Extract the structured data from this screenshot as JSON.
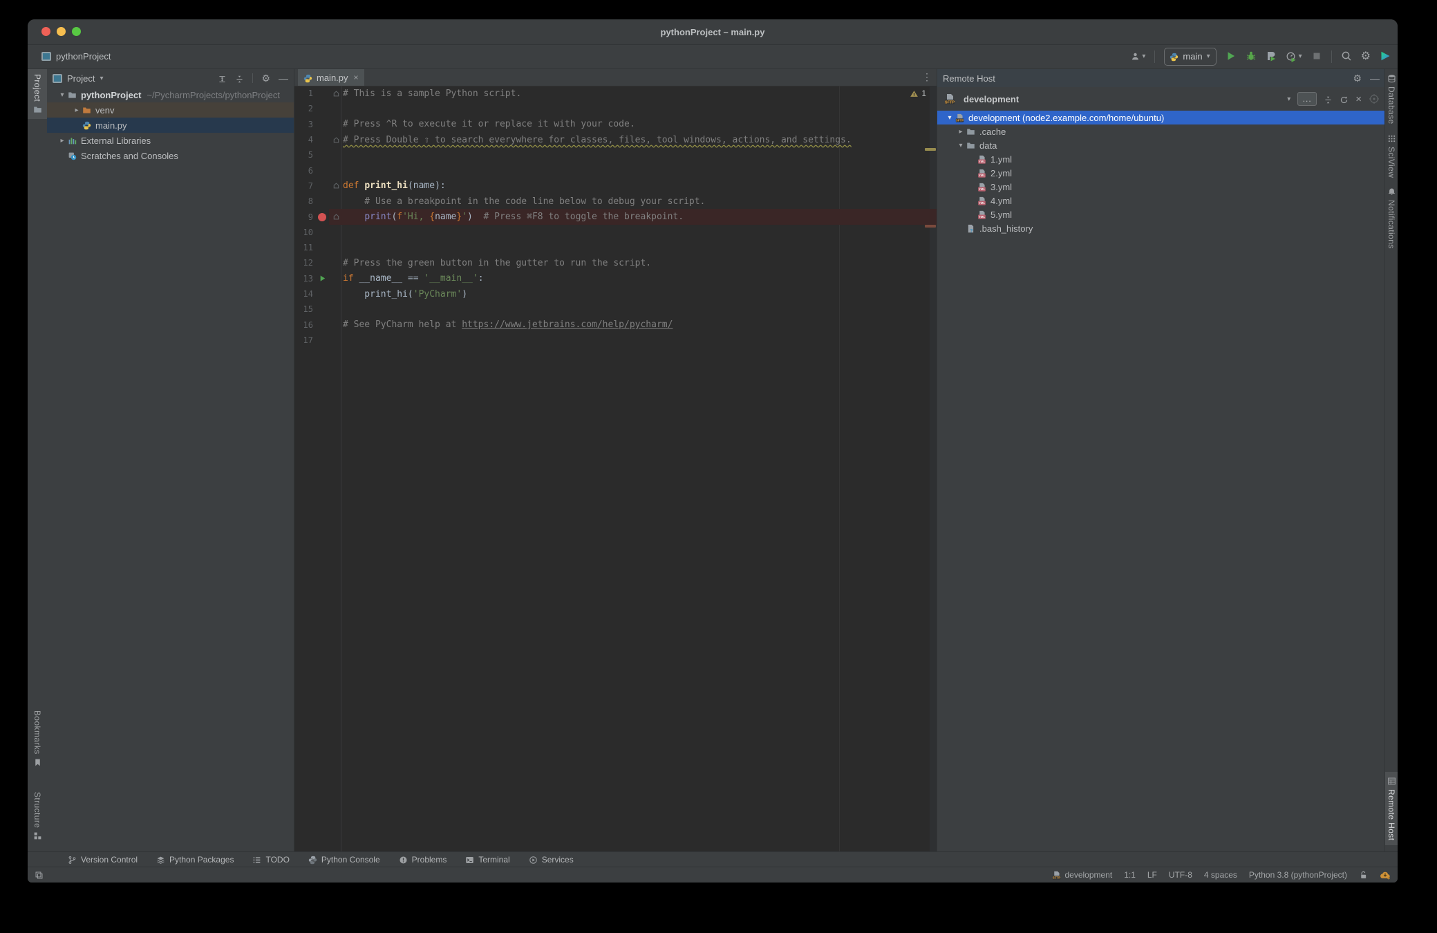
{
  "colors": {
    "panel_bg": "#3c3f41",
    "editor_bg": "#2b2b2b",
    "selection_focused": "#2f65c9",
    "selection_unfocused": "#27394d",
    "hover_row": "#46413a",
    "breakpoint_line": "#3a2626",
    "breakpoint_dot": "#d25252",
    "comment": "#808080",
    "keyword": "#cc7832",
    "string": "#6a8759",
    "builtin": "#8888c6",
    "plain_text": "#a9b7c6",
    "run_green": "#51a653",
    "warning_mark": "#968b4e",
    "stripe_mark_brown": "#7a4a3d"
  },
  "titlebar": {
    "title": "pythonProject – main.py"
  },
  "toolbar": {
    "breadcrumb": "pythonProject",
    "run_config": "main"
  },
  "project_panel": {
    "title": "Project",
    "tree": [
      {
        "indent": 0,
        "chevron": "down",
        "icon": "folder",
        "name": "pythonProject",
        "bold": true,
        "path": "~/PycharmProjects/pythonProject",
        "state": "none"
      },
      {
        "indent": 1,
        "chevron": "right",
        "icon": "folder-excluded",
        "name": "venv",
        "state": "hover"
      },
      {
        "indent": 1,
        "chevron": "none",
        "icon": "python",
        "name": "main.py",
        "state": "selected-unfocused"
      },
      {
        "indent": 0,
        "chevron": "right",
        "icon": "libraries",
        "name": "External Libraries",
        "state": "none"
      },
      {
        "indent": 0,
        "chevron": "none",
        "icon": "scratches",
        "name": "Scratches and Consoles",
        "state": "none"
      }
    ]
  },
  "editor": {
    "tab_label": "main.py",
    "warning_badge": "1",
    "lines": [
      {
        "n": 1,
        "fold": true,
        "seg": [
          [
            "c",
            "# This is a sample Python script."
          ]
        ]
      },
      {
        "n": 2,
        "seg": []
      },
      {
        "n": 3,
        "seg": [
          [
            "c",
            "# Press ^R to execute it or replace it with your code."
          ]
        ]
      },
      {
        "n": 4,
        "fold": true,
        "seg": [
          [
            "cw",
            "# Press Double ⇧ to search everywhere for classes, files, tool windows, actions, and settings."
          ]
        ]
      },
      {
        "n": 5,
        "seg": []
      },
      {
        "n": 6,
        "seg": []
      },
      {
        "n": 7,
        "fold": true,
        "seg": [
          [
            "k",
            "def "
          ],
          [
            "fd",
            "print_hi"
          ],
          [
            "p",
            "(name):"
          ]
        ]
      },
      {
        "n": 8,
        "seg": [
          [
            "c",
            "    # Use a breakpoint in the code line below to debug your script."
          ]
        ]
      },
      {
        "n": 9,
        "breakpoint": true,
        "fold": true,
        "highlight": true,
        "seg": [
          [
            "p",
            "    "
          ],
          [
            "b",
            "print"
          ],
          [
            "p",
            "("
          ],
          [
            "k",
            "f"
          ],
          [
            "s",
            "'Hi, "
          ],
          [
            "k",
            "{"
          ],
          [
            "p",
            "name"
          ],
          [
            "k",
            "}"
          ],
          [
            "s",
            "'"
          ],
          [
            "p",
            ")"
          ],
          [
            "c",
            "  # Press ⌘F8 to toggle the breakpoint."
          ]
        ]
      },
      {
        "n": 10,
        "seg": []
      },
      {
        "n": 11,
        "seg": []
      },
      {
        "n": 12,
        "seg": [
          [
            "c",
            "# Press the green button in the gutter to run the script."
          ]
        ]
      },
      {
        "n": 13,
        "run": true,
        "seg": [
          [
            "k",
            "if "
          ],
          [
            "p",
            "__name__ == "
          ],
          [
            "s",
            "'__main__'"
          ],
          [
            "p",
            ":"
          ]
        ]
      },
      {
        "n": 14,
        "seg": [
          [
            "p",
            "    print_hi("
          ],
          [
            "s",
            "'PyCharm'"
          ],
          [
            "p",
            ")"
          ]
        ]
      },
      {
        "n": 15,
        "seg": []
      },
      {
        "n": 16,
        "seg": [
          [
            "c",
            "# See PyCharm help at "
          ],
          [
            "cl",
            "https://www.jetbrains.com/help/pycharm/"
          ]
        ]
      },
      {
        "n": 17,
        "seg": []
      }
    ]
  },
  "remote_panel": {
    "title": "Remote Host",
    "server_combo": "development",
    "browse_label": "...",
    "tree": [
      {
        "indent": 0,
        "chevron": "down",
        "icon": "sftp",
        "name": "development (node2.example.com/home/ubuntu)",
        "state": "selected-focused"
      },
      {
        "indent": 1,
        "chevron": "right",
        "icon": "folder",
        "name": ".cache",
        "state": "none"
      },
      {
        "indent": 1,
        "chevron": "down",
        "icon": "folder",
        "name": "data",
        "state": "none"
      },
      {
        "indent": 2,
        "chevron": "none",
        "icon": "yml",
        "name": "1.yml",
        "state": "none"
      },
      {
        "indent": 2,
        "chevron": "none",
        "icon": "yml",
        "name": "2.yml",
        "state": "none"
      },
      {
        "indent": 2,
        "chevron": "none",
        "icon": "yml",
        "name": "3.yml",
        "state": "none"
      },
      {
        "indent": 2,
        "chevron": "none",
        "icon": "yml",
        "name": "4.yml",
        "state": "none"
      },
      {
        "indent": 2,
        "chevron": "none",
        "icon": "yml",
        "name": "5.yml",
        "state": "none"
      },
      {
        "indent": 1,
        "chevron": "none",
        "icon": "file-unknown",
        "name": ".bash_history",
        "state": "none"
      }
    ]
  },
  "left_stripe_top": [
    {
      "label": "Project",
      "icon": "folder",
      "active": true
    }
  ],
  "left_stripe_bottom": [
    {
      "label": "Bookmarks",
      "icon": "bookmark",
      "active": false
    },
    {
      "label": "Structure",
      "icon": "structure",
      "active": false
    }
  ],
  "right_stripe_top": [
    {
      "label": "Database",
      "icon": "database",
      "active": false
    },
    {
      "label": "SciView",
      "icon": "sciview",
      "active": false
    },
    {
      "label": "Notifications",
      "icon": "bell",
      "active": false
    }
  ],
  "right_stripe_bottom": [
    {
      "label": "Remote Host",
      "icon": "remote",
      "active": true
    }
  ],
  "bottom_buttons": [
    {
      "label": "Version Control",
      "icon": "branch"
    },
    {
      "label": "Python Packages",
      "icon": "packages"
    },
    {
      "label": "TODO",
      "icon": "todo"
    },
    {
      "label": "Python Console",
      "icon": "pyconsole"
    },
    {
      "label": "Problems",
      "icon": "problems"
    },
    {
      "label": "Terminal",
      "icon": "terminal"
    },
    {
      "label": "Services",
      "icon": "services"
    }
  ],
  "status_bar": {
    "items": [
      {
        "label": "development",
        "icon": "sftp"
      },
      {
        "label": "1:1"
      },
      {
        "label": "LF"
      },
      {
        "label": "UTF-8"
      },
      {
        "label": "4 spaces"
      },
      {
        "label": "Python 3.8 (pythonProject)"
      }
    ]
  }
}
